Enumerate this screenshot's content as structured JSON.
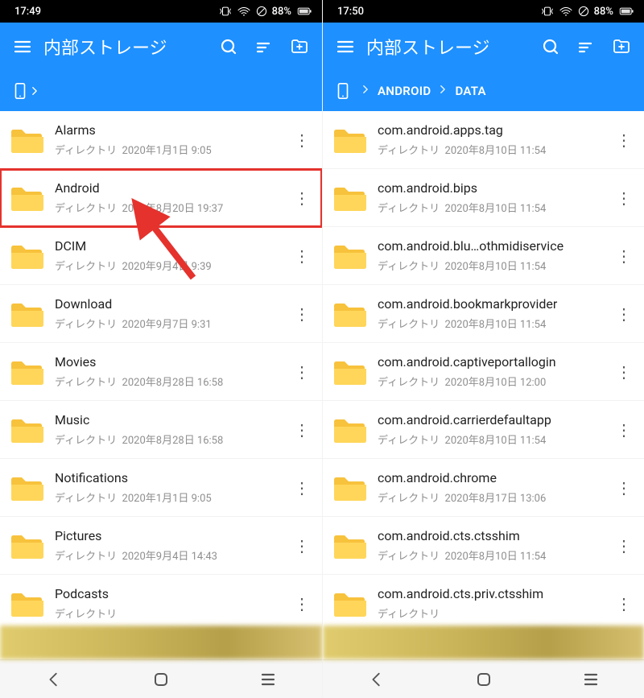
{
  "left": {
    "status": {
      "time": "17:49",
      "battery": "88%"
    },
    "title": "内部ストレージ",
    "breadcrumb": [
      "root"
    ],
    "items": [
      {
        "name": "Alarms",
        "type": "ディレクトリ",
        "date": "2020年1月1日 9:05"
      },
      {
        "name": "Android",
        "type": "ディレクトリ",
        "date": "2020年8月20日 19:37",
        "highlight": true
      },
      {
        "name": "DCIM",
        "type": "ディレクトリ",
        "date": "2020年9月4日 9:39"
      },
      {
        "name": "Download",
        "type": "ディレクトリ",
        "date": "2020年9月7日 9:31"
      },
      {
        "name": "Movies",
        "type": "ディレクトリ",
        "date": "2020年8月28日 16:58"
      },
      {
        "name": "Music",
        "type": "ディレクトリ",
        "date": "2020年8月28日 16:58"
      },
      {
        "name": "Notifications",
        "type": "ディレクトリ",
        "date": "2020年1月1日 9:05"
      },
      {
        "name": "Pictures",
        "type": "ディレクトリ",
        "date": "2020年9月4日 14:43"
      },
      {
        "name": "Podcasts",
        "type": "ディレクトリ",
        "date": ""
      }
    ]
  },
  "right": {
    "status": {
      "time": "17:50",
      "battery": "88%"
    },
    "title": "内部ストレージ",
    "breadcrumb": [
      "ANDROID",
      "DATA"
    ],
    "items": [
      {
        "name": "com.android.apps.tag",
        "type": "ディレクトリ",
        "date": "2020年8月10日 11:54"
      },
      {
        "name": "com.android.bips",
        "type": "ディレクトリ",
        "date": "2020年8月10日 11:54"
      },
      {
        "name": "com.android.blu…othmidiservice",
        "type": "ディレクトリ",
        "date": "2020年8月10日 11:54"
      },
      {
        "name": "com.android.bookmarkprovider",
        "type": "ディレクトリ",
        "date": "2020年8月10日 11:54"
      },
      {
        "name": "com.android.captiveportallogin",
        "type": "ディレクトリ",
        "date": "2020年8月10日 12:00"
      },
      {
        "name": "com.android.carrierdefaultapp",
        "type": "ディレクトリ",
        "date": "2020年8月10日 11:54"
      },
      {
        "name": "com.android.chrome",
        "type": "ディレクトリ",
        "date": "2020年8月17日 13:06"
      },
      {
        "name": "com.android.cts.ctsshim",
        "type": "ディレクトリ",
        "date": "2020年8月10日 11:54"
      },
      {
        "name": "com.android.cts.priv.ctsshim",
        "type": "ディレクトリ",
        "date": ""
      }
    ]
  }
}
